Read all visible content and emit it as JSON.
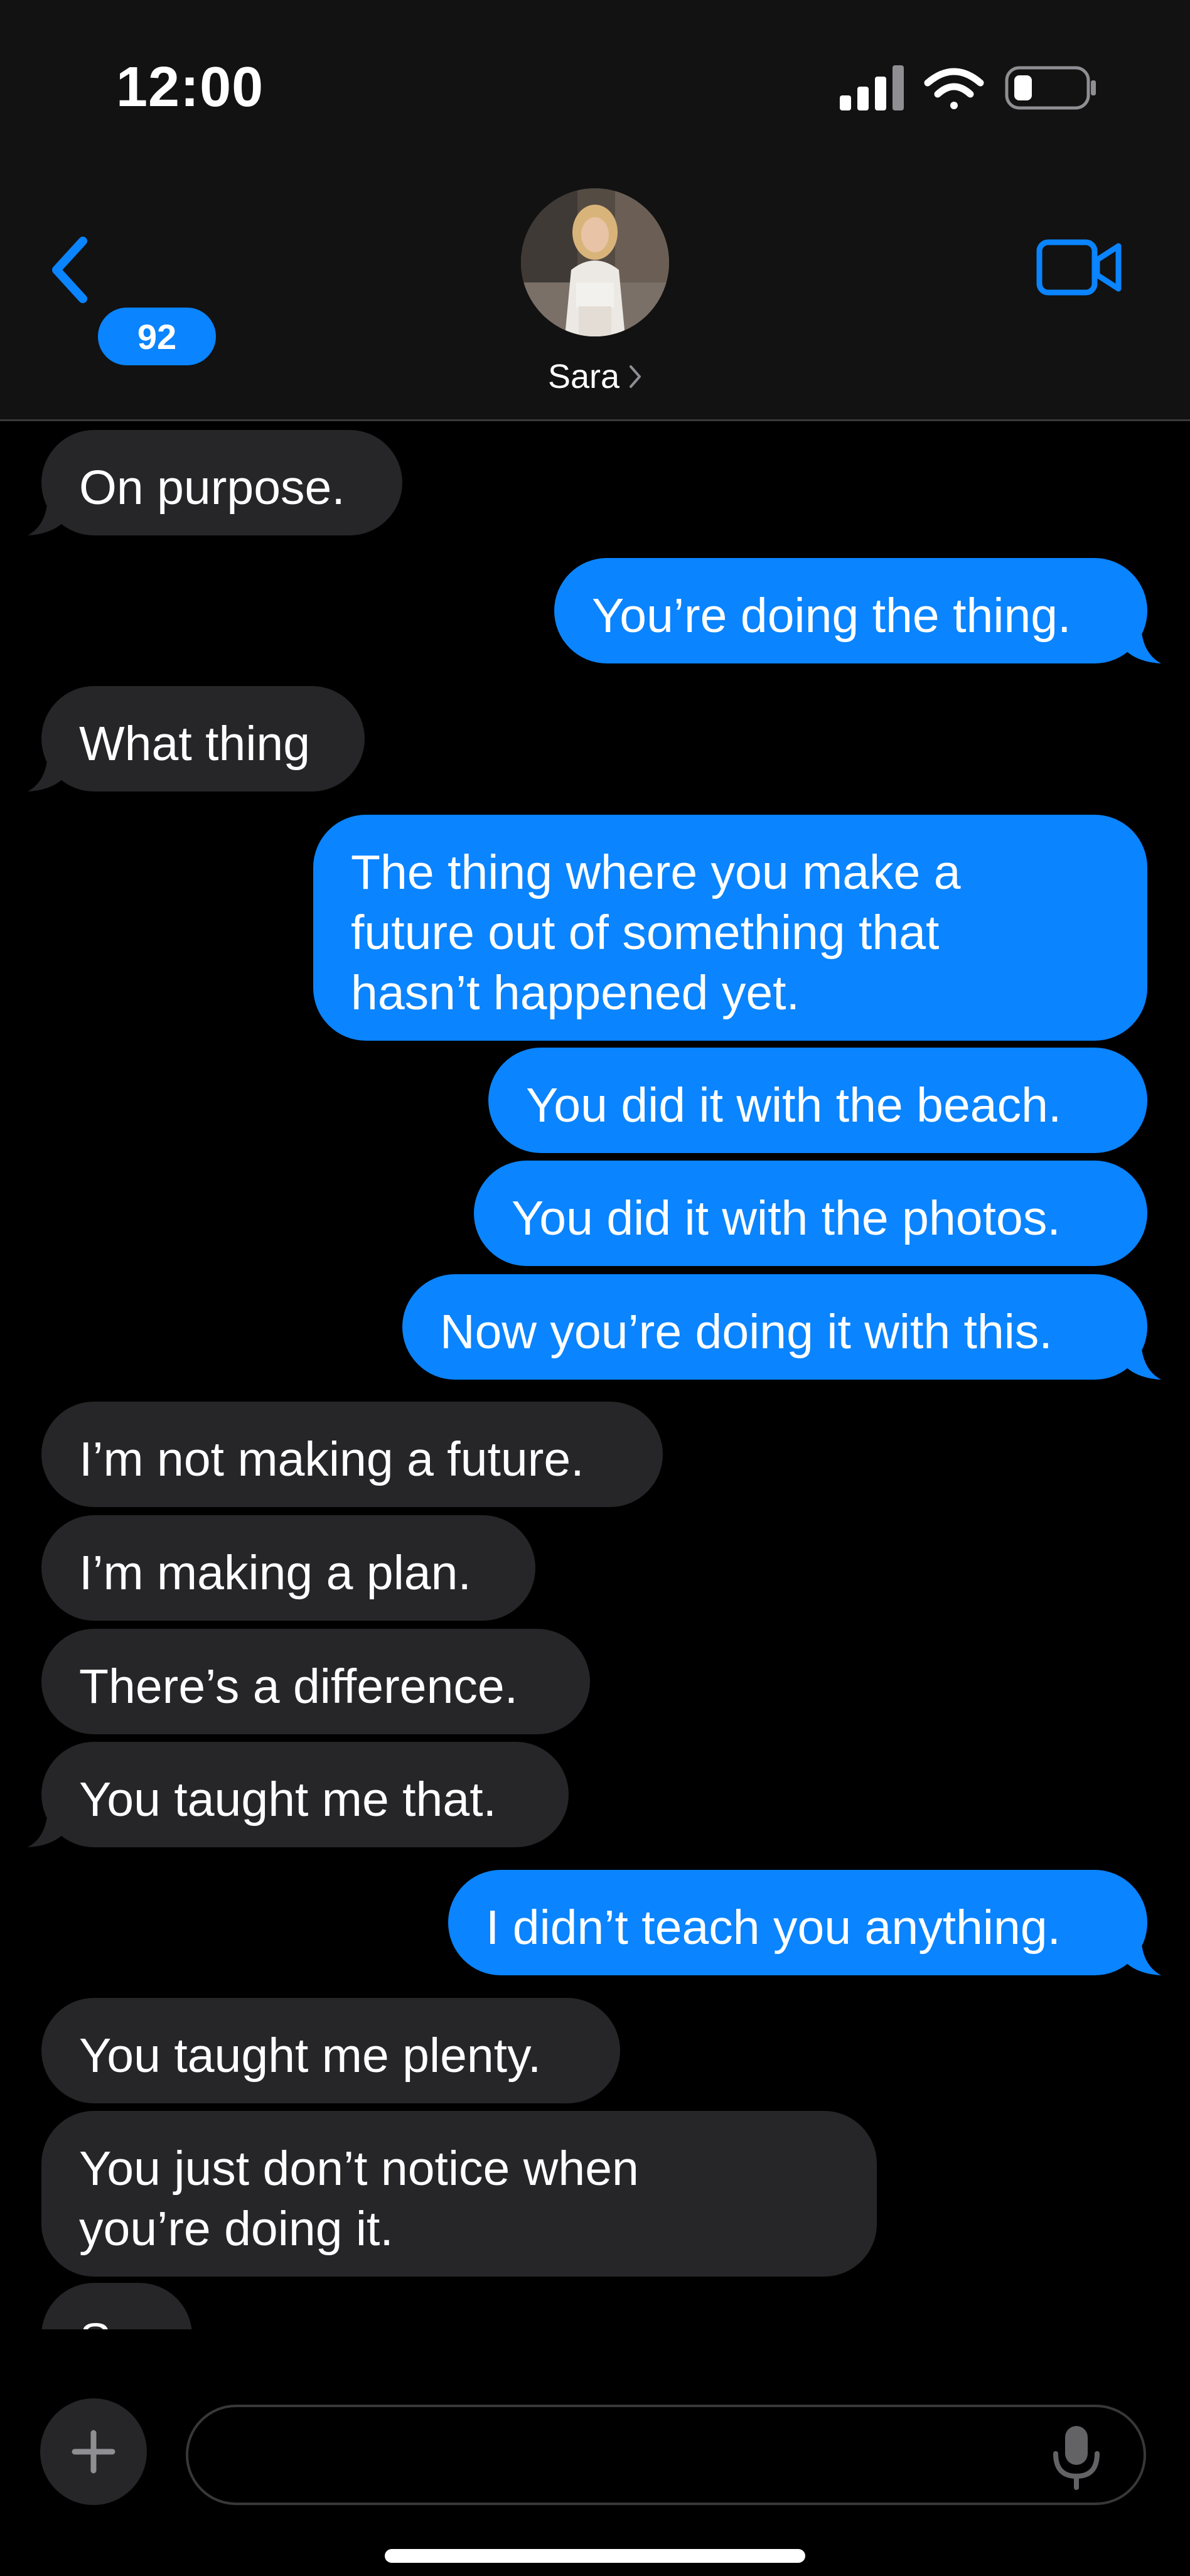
{
  "status_bar": {
    "time": "12:00",
    "icons": [
      "cellular-signal-icon",
      "wifi-icon",
      "battery-icon"
    ]
  },
  "header": {
    "back_badge": "92",
    "contact_name": "Sara",
    "icons": [
      "back-chevron-icon",
      "video-camera-icon",
      "contact-chevron-icon"
    ]
  },
  "colors": {
    "incoming_bubble": "#262628",
    "outgoing_bubble": "#0a84ff",
    "accent": "#0a84ff",
    "header_bg": "#121212"
  },
  "messages": [
    {
      "from": "incoming",
      "text": "On purpose."
    },
    {
      "from": "outgoing",
      "text": "You’re doing the thing."
    },
    {
      "from": "incoming",
      "text": "What thing"
    },
    {
      "from": "outgoing",
      "text": "The thing where you make a\nfuture out of something that\nhasn’t happened yet."
    },
    {
      "from": "outgoing",
      "text": "You did it with the beach."
    },
    {
      "from": "outgoing",
      "text": "You did it with the photos."
    },
    {
      "from": "outgoing",
      "text": "Now you’re doing it with this."
    },
    {
      "from": "incoming",
      "text": "I’m not making a future."
    },
    {
      "from": "incoming",
      "text": "I’m making a plan."
    },
    {
      "from": "incoming",
      "text": "There’s a difference."
    },
    {
      "from": "incoming",
      "text": "You taught me that."
    },
    {
      "from": "outgoing",
      "text": "I didn’t teach you anything."
    },
    {
      "from": "incoming",
      "text": "You taught me plenty."
    },
    {
      "from": "incoming",
      "text": "You just don’t notice when\nyou’re doing it."
    },
    {
      "from": "incoming",
      "text": "So"
    }
  ],
  "input_bar": {
    "placeholder": "",
    "icons": [
      "plus-icon",
      "microphone-icon"
    ]
  }
}
